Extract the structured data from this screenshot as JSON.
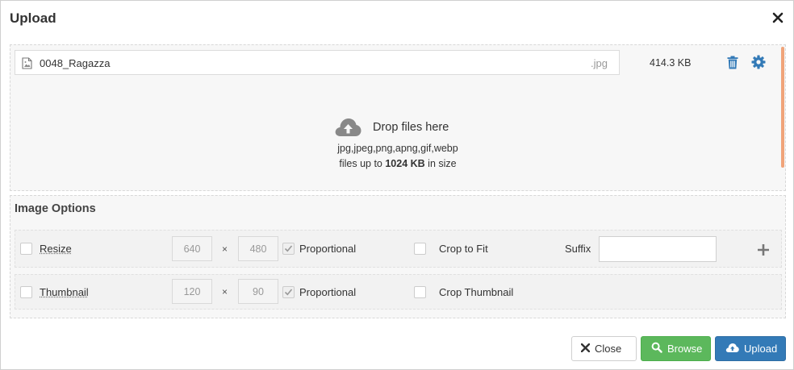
{
  "dialog": {
    "title": "Upload",
    "close_icon": "close-icon"
  },
  "file": {
    "icon": "image-file-icon",
    "name": "0048_Ragazza",
    "extension": ".jpg",
    "size": "414.3 KB",
    "delete_icon": "trash-icon",
    "settings_icon": "gear-icon"
  },
  "dropzone": {
    "icon": "cloud-upload-icon",
    "title": "Drop files here",
    "types": "jpg,jpeg,png,apng,gif,webp",
    "limit_prefix": "files up to ",
    "limit_value": "1024 KB",
    "limit_suffix": " in size"
  },
  "image_options": {
    "title": "Image Options",
    "resize": {
      "label": "Resize",
      "checked": false,
      "width": "640",
      "height": "480",
      "times": "×",
      "proportional_label": "Proportional",
      "proportional_checked": true,
      "crop_label": "Crop to Fit",
      "crop_checked": false,
      "suffix_label": "Suffix",
      "suffix_value": ""
    },
    "thumbnail": {
      "label": "Thumbnail",
      "checked": false,
      "width": "120",
      "height": "90",
      "times": "×",
      "proportional_label": "Proportional",
      "proportional_checked": true,
      "crop_label": "Crop Thumbnail",
      "crop_checked": false
    },
    "add_icon": "plus-icon"
  },
  "buttons": {
    "close": "Close",
    "browse": "Browse",
    "upload": "Upload"
  },
  "colors": {
    "browse": "#5cb85c",
    "upload": "#337ab7",
    "icon_blue": "#337ab7",
    "scrollbar": "#f0a47a"
  }
}
